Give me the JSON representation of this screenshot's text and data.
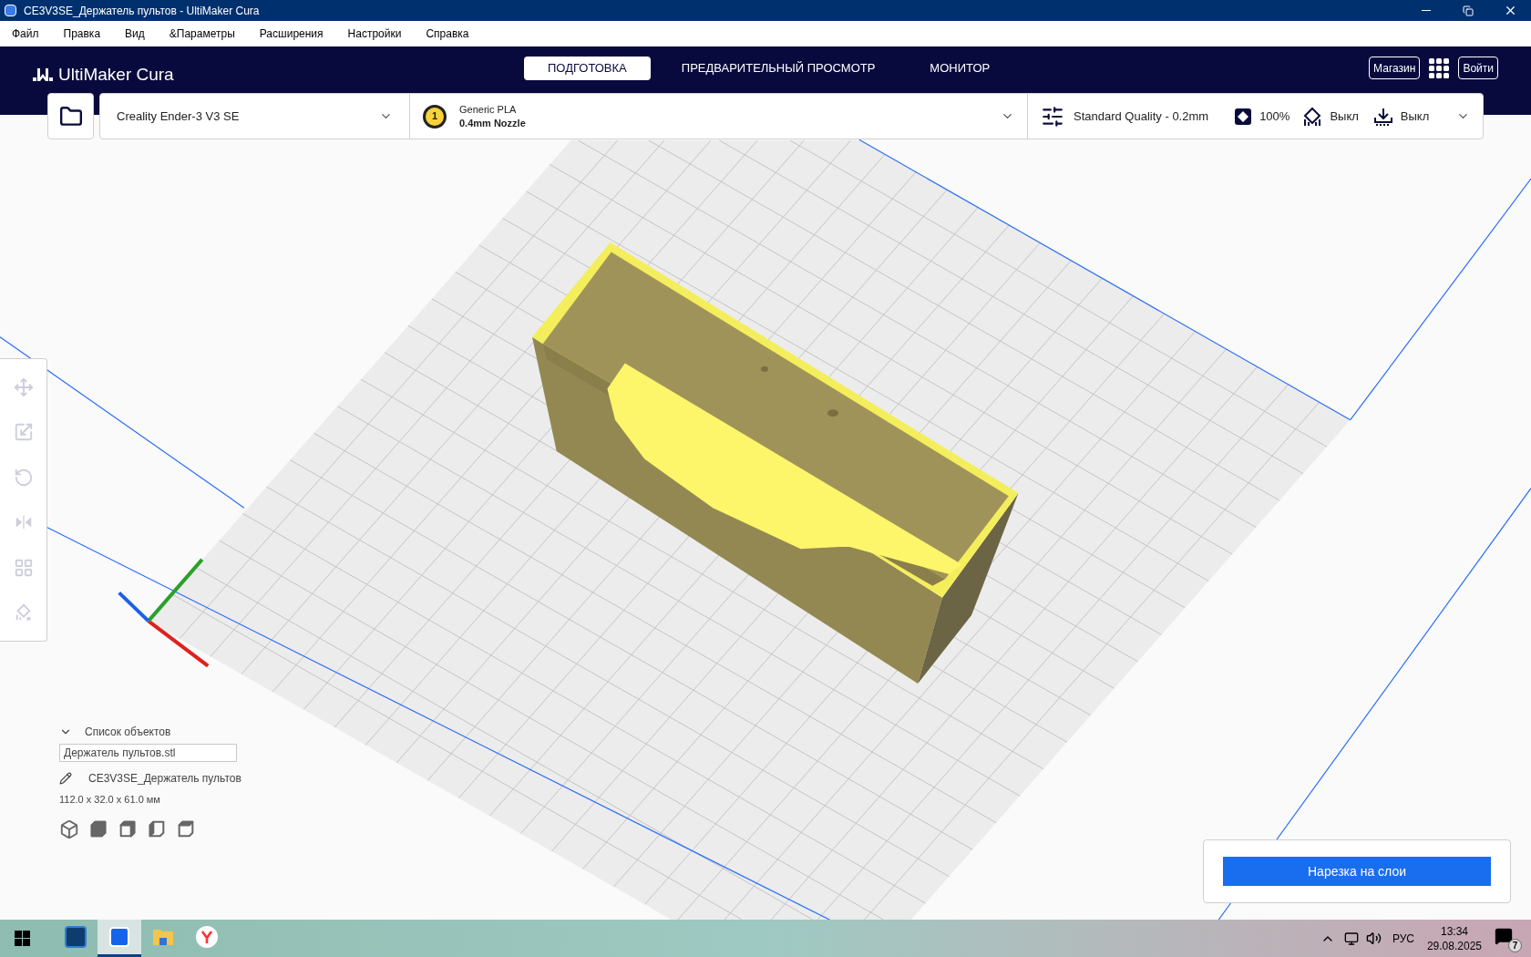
{
  "window": {
    "title": "CE3V3SE_Держатель пультов - UltiMaker Cura"
  },
  "menu": [
    "Файл",
    "Правка",
    "Вид",
    "&Параметры",
    "Расширения",
    "Настройки",
    "Справка"
  ],
  "header": {
    "logo": "UltiMaker Cura",
    "tabs": [
      {
        "label": "ПОДГОТОВКА",
        "selected": true
      },
      {
        "label": "ПРЕДВАРИТЕЛЬНЫЙ ПРОСМОТР",
        "selected": false
      },
      {
        "label": "МОНИТОР",
        "selected": false
      }
    ],
    "marketplace": "Магазин",
    "sign_in": "Войти"
  },
  "toolbar": {
    "printer": "Creality Ender-3 V3 SE",
    "extruder": {
      "number": "1",
      "material": "Generic PLA",
      "nozzle": "0.4mm Nozzle"
    },
    "print_settings": {
      "profile": "Standard Quality - 0.2mm",
      "infill": "100%",
      "support": "Выкл",
      "adhesion": "Выкл"
    }
  },
  "tools": [
    {
      "kind": "move",
      "disabled": true
    },
    {
      "kind": "scale",
      "disabled": true
    },
    {
      "kind": "rotate",
      "disabled": true
    },
    {
      "kind": "mirror",
      "disabled": true
    },
    {
      "kind": "per_model",
      "disabled": true
    },
    {
      "kind": "support_blocker",
      "disabled": true
    }
  ],
  "object_list": {
    "title": "Список объектов",
    "expanded": true,
    "items": [
      "Держатель пультов.stl"
    ],
    "job_name": "CE3V3SE_Держатель пультов",
    "dimensions": "112.0 x 32.0 x 61.0 мм"
  },
  "view_buttons": [
    {
      "kind": "perspective"
    },
    {
      "kind": "front"
    },
    {
      "kind": "top"
    },
    {
      "kind": "left"
    },
    {
      "kind": "right"
    }
  ],
  "slice_button": "Нарезка на слои",
  "taskbar": {
    "apps": [
      {
        "kind": "sync",
        "selected": false
      },
      {
        "kind": "cura",
        "selected": true
      },
      {
        "kind": "files",
        "selected": false
      },
      {
        "kind": "browser",
        "selected": false
      }
    ],
    "language": "РУС",
    "time": "13:34",
    "date": "29.08.2025",
    "notifications": "7"
  }
}
